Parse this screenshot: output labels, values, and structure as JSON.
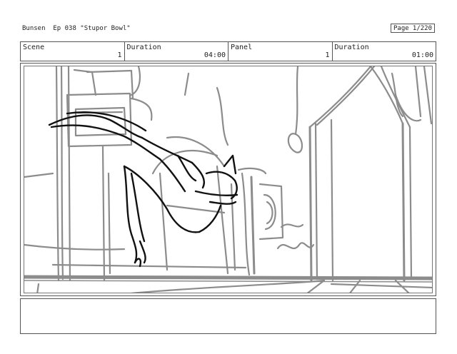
{
  "header": {
    "title": "Bunsen  Ep 038 \"Stupor Bowl\"",
    "page_label": "Page",
    "page_value": "1/220"
  },
  "panel_info": [
    {
      "label": "Scene",
      "value": "1"
    },
    {
      "label": "Duration",
      "value": "04:00"
    },
    {
      "label": "Panel",
      "value": "1"
    },
    {
      "label": "Duration",
      "value": "01:00"
    }
  ],
  "notes": {
    "text": ""
  },
  "colors": {
    "sketch_gray": "#8c8c8c",
    "sketch_black": "#111111",
    "border": "#555555"
  }
}
